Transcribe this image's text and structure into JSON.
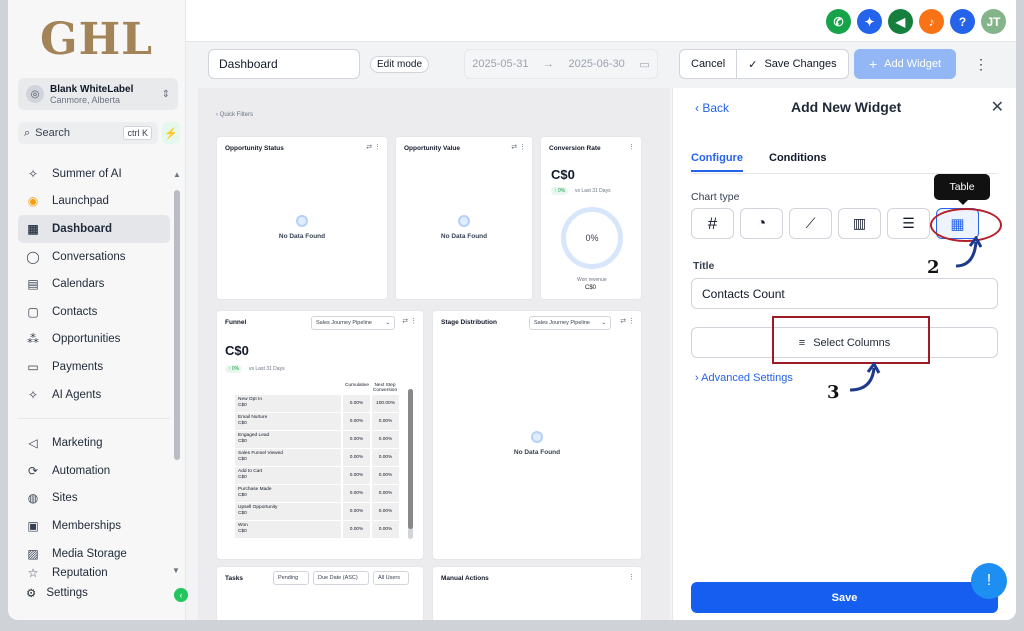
{
  "logo": "GHL",
  "account": {
    "name": "Blank WhiteLabel",
    "location": "Canmore, Alberta"
  },
  "search": {
    "placeholder": "Search",
    "shortcut": "ctrl K"
  },
  "nav": {
    "summer": "Summer of AI",
    "launchpad": "Launchpad",
    "dashboard": "Dashboard",
    "conversations": "Conversations",
    "calendars": "Calendars",
    "contacts": "Contacts",
    "opportunities": "Opportunities",
    "payments": "Payments",
    "ai_agents": "AI Agents",
    "marketing": "Marketing",
    "automation": "Automation",
    "sites": "Sites",
    "memberships": "Memberships",
    "media_storage": "Media Storage",
    "reputation": "Reputation",
    "settings": "Settings"
  },
  "topbar": {
    "avatar_initials": "JT"
  },
  "toolbar": {
    "dashboard_name": "Dashboard",
    "edit_mode": "Edit mode",
    "date_from": "2025-05-31",
    "date_to": "2025-06-30",
    "cancel": "Cancel",
    "save_changes": "Save Changes",
    "add_widget": "Add Widget"
  },
  "canvas": {
    "quick_filters": "Quick Filters",
    "opportunity_status": {
      "title": "Opportunity Status",
      "empty": "No Data Found"
    },
    "opportunity_value": {
      "title": "Opportunity Value",
      "empty": "No Data Found"
    },
    "conversion_rate": {
      "title": "Conversion Rate",
      "value": "C$0",
      "change": "0%",
      "vs": "vs Last 31 Days",
      "ring": "0%",
      "caption": "Won revenue",
      "footer": "C$0"
    },
    "funnel": {
      "title": "Funnel",
      "pipeline": "Sales Journey Pipeline",
      "value": "C$0",
      "change": "0%",
      "vs": "vs Last 31 Days",
      "col_cumulative": "Cumulative",
      "col_next": "Next Step Conversion",
      "rows": [
        {
          "name": "New Opt In",
          "amt": "C$0",
          "cum": "0.00%",
          "next": "100.00%"
        },
        {
          "name": "Email Nurture",
          "amt": "C$0",
          "cum": "0.00%",
          "next": "0.00%"
        },
        {
          "name": "Engaged Lead",
          "amt": "C$0",
          "cum": "0.00%",
          "next": "0.00%"
        },
        {
          "name": "Sales Funnel Viewed",
          "amt": "C$0",
          "cum": "0.00%",
          "next": "0.00%"
        },
        {
          "name": "Add to Cart",
          "amt": "C$0",
          "cum": "0.00%",
          "next": "0.00%"
        },
        {
          "name": "Purchase Made",
          "amt": "C$0",
          "cum": "0.00%",
          "next": "0.00%"
        },
        {
          "name": "Upsell Opportunity",
          "amt": "C$0",
          "cum": "0.00%",
          "next": "0.00%"
        },
        {
          "name": "Won",
          "amt": "C$0",
          "cum": "0.00%",
          "next": "0.00%"
        }
      ]
    },
    "stage_distribution": {
      "title": "Stage Distribution",
      "pipeline": "Sales Journey Pipeline",
      "empty": "No Data Found"
    },
    "tasks": {
      "title": "Tasks",
      "status": "Pending",
      "sort": "Due Date (ASC)",
      "users": "All Users"
    },
    "manual_actions": {
      "title": "Manual Actions"
    }
  },
  "panel": {
    "back": "Back",
    "title": "Add New Widget",
    "tab_configure": "Configure",
    "tab_conditions": "Conditions",
    "chart_type_label": "Chart type",
    "tooltip": "Table",
    "title_label": "Title",
    "title_value": "Contacts Count",
    "select_columns": "Select Columns",
    "advanced": "Advanced Settings",
    "save": "Save"
  },
  "annotations": {
    "step2": "2",
    "step3": "3"
  },
  "colors": {
    "primary": "#155eef",
    "highlight": "#b3202a",
    "logo": "#a38458"
  }
}
